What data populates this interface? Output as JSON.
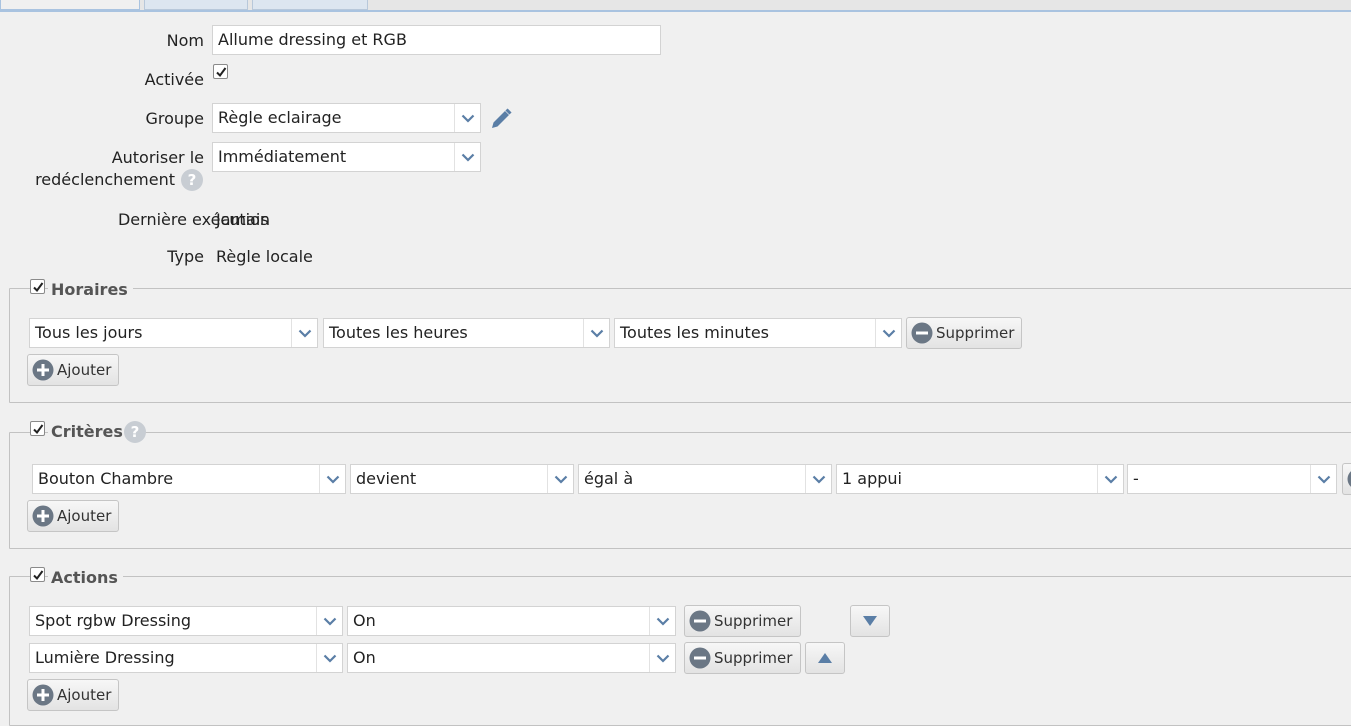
{
  "form": {
    "name_label": "Nom",
    "name_value": "Allume dressing et RGB",
    "enabled_label": "Activée",
    "group_label": "Groupe",
    "group_value": "Règle eclairage",
    "retrigger_label_line1": "Autoriser le",
    "retrigger_label_line2": "redéclenchement",
    "retrigger_value": "Immédiatement",
    "last_exec_label": "Dernière exécution",
    "last_exec_value": "Jamais",
    "type_label": "Type",
    "type_value": "Règle locale"
  },
  "horaires": {
    "title": "Horaires",
    "days": "Tous les jours",
    "hours": "Toutes les heures",
    "minutes": "Toutes les minutes",
    "delete_label": "Supprimer",
    "add_label": "Ajouter"
  },
  "criteres": {
    "title": "Critères",
    "device": "Bouton Chambre",
    "verb": "devient",
    "operator": "égal à",
    "value": "1 appui",
    "extra": "-",
    "add_label": "Ajouter"
  },
  "actions": {
    "title": "Actions",
    "rows": [
      {
        "device": "Spot rgbw Dressing",
        "value": "On",
        "delete_label": "Supprimer"
      },
      {
        "device": "Lumière Dressing",
        "value": "On",
        "delete_label": "Supprimer"
      }
    ],
    "add_label": "Ajouter"
  },
  "help_glyph": "?",
  "colors": {
    "accent": "#5a7ea6",
    "icon_gray": "#6b7785"
  }
}
